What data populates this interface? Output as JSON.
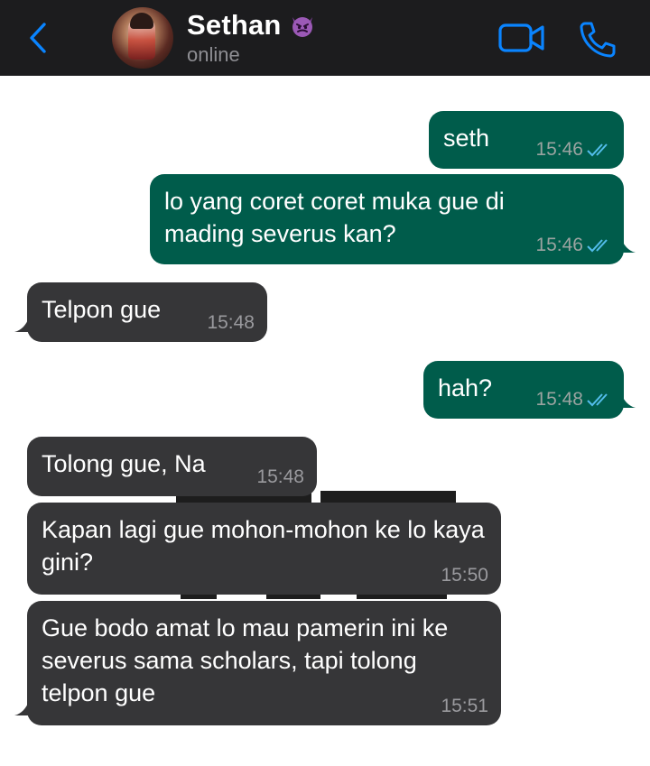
{
  "header": {
    "back_icon": "chevron-left-icon",
    "contact_name": "Sethan",
    "contact_emoji": "smiling-devil-emoji",
    "status": "online",
    "video_icon": "video-camera-icon",
    "phone_icon": "phone-icon",
    "accent_color": "#0a84ff"
  },
  "messages": [
    {
      "direction": "out",
      "text": "seth",
      "time": "15:46",
      "read": true
    },
    {
      "direction": "out",
      "text": "lo yang coret coret muka gue di mading severus kan?",
      "time": "15:46",
      "read": true
    },
    {
      "direction": "in",
      "text": "Telpon gue",
      "time": "15:48"
    },
    {
      "direction": "out",
      "text": "hah?",
      "time": "15:48",
      "read": true
    },
    {
      "direction": "in",
      "text": "Tolong gue, Na",
      "time": "15:48"
    },
    {
      "direction": "in",
      "text": "Kapan lagi gue mohon-mohon ke lo kaya gini?",
      "time": "15:50"
    },
    {
      "direction": "in",
      "text": "Gue bodo amat lo mau pamerin ini ke severus sama scholars, tapi tolong telpon gue",
      "time": "15:51"
    }
  ],
  "colors": {
    "outgoing_bubble": "#005c4b",
    "incoming_bubble": "#363638",
    "read_ticks": "#53bdeb"
  }
}
